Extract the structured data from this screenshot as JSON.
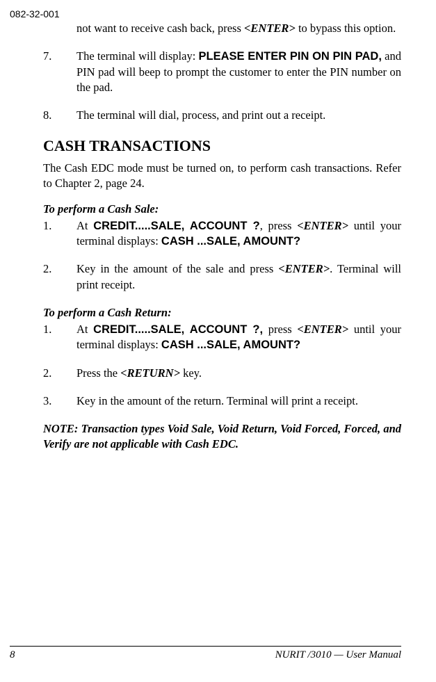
{
  "header": {
    "docnum": "082-32-001"
  },
  "body": {
    "cont_para": "not want to receive cash back, press ",
    "cont_key": "<ENTER>",
    "cont_para2": " to bypass this option.",
    "item7": {
      "num": "7.",
      "t1": "The terminal will display: ",
      "t2": "PLEASE ENTER PIN ON PIN PAD,",
      "t3": " and PIN pad will beep to prompt the customer to enter the PIN number on the pad."
    },
    "item8": {
      "num": "8.",
      "t1": "The terminal will dial, process, and print out a receipt."
    },
    "section_title": "CASH TRANSACTIONS",
    "section_intro": "The Cash EDC mode must be turned on, to perform cash transactions. Refer to Chapter 2, page 24.",
    "sale_heading": "To perform a Cash Sale:",
    "sale1": {
      "num": "1.",
      "t1": "At ",
      "t2": "CREDIT.....SALE, ACCOUNT ?",
      "t3": ", press ",
      "key": "<ENTER>",
      "t4": " until your terminal displays: ",
      "t5": "CASH ...SALE, AMOUNT?"
    },
    "sale2": {
      "num": "2.",
      "t1": "Key in the amount of the sale and press ",
      "key": "<ENTER>",
      "t2": ". Terminal will print receipt."
    },
    "return_heading": "To perform a Cash Return:",
    "ret1": {
      "num": "1.",
      "t1": "At ",
      "t2": "CREDIT.....SALE, ACCOUNT ?,",
      "t3": " press ",
      "key": "<ENTER>",
      "t4": " until your terminal displays: ",
      "t5": "CASH ...SALE, AMOUNT?"
    },
    "ret2": {
      "num": "2.",
      "t1": "Press the ",
      "key": "<RETURN>",
      "t2": " key."
    },
    "ret3": {
      "num": "3.",
      "t1": "Key in the amount of the return.  Terminal will print a receipt."
    },
    "note": "NOTE:  Transaction types Void Sale, Void Return, Void Forced, Forced, and Verify are not applicable with Cash EDC."
  },
  "footer": {
    "page": "8",
    "manual": "NURIT /3010 — User Manual"
  }
}
